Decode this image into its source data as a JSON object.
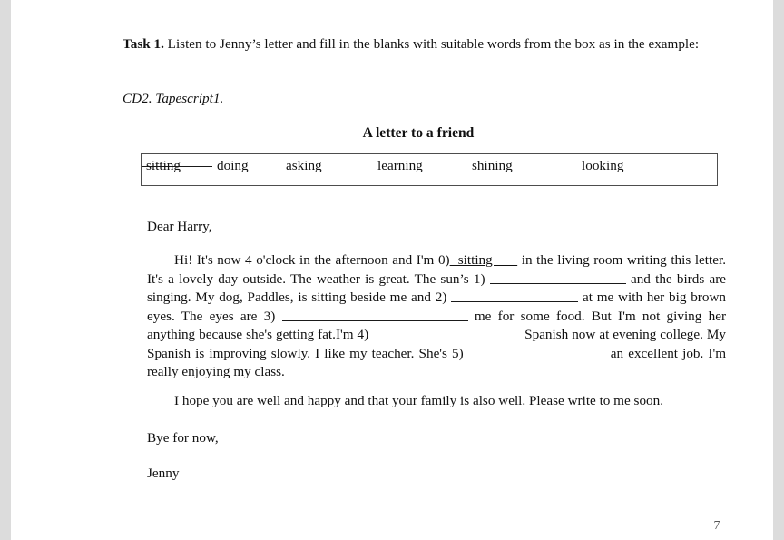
{
  "document": {
    "page_number": "7"
  },
  "task": {
    "label": "Task 1.",
    "instruction": " Listen to Jenny’s letter and fill in the blanks with suitable words from the box as in the example:",
    "tapescript": "CD2. Tapescript1."
  },
  "letter": {
    "title": "A letter to a friend",
    "salutation": "Dear Harry,",
    "signoff": "Bye for now,",
    "signature": "Jenny"
  },
  "word_bank": {
    "words": [
      {
        "text": "sitting",
        "struck": true
      },
      {
        "text": "doing",
        "struck": false
      },
      {
        "text": "asking",
        "struck": false
      },
      {
        "text": "learning",
        "struck": false
      },
      {
        "text": "shining",
        "struck": false
      },
      {
        "text": "looking",
        "struck": false
      }
    ]
  },
  "body": {
    "seg_1": "Hi! It's now 4 o'clock in the afternoon and I'm 0)",
    "example_answer": "  sitting      ",
    "seg_2": " in the living room writing this letter. It's a lovely day outside. The weather is great. The sun’s 1)",
    "seg_3": " and the birds are singing. My dog, Paddles, is sitting beside me and 2)",
    "seg_4": " at me with her big brown eyes. The eyes are 3)",
    "seg_5": " me for some food. But I'm not giving her anything because she's getting fat.I'm 4)",
    "seg_6": " Spanish now at evening college. My Spanish is improving slowly. I like my teacher. She's 5)",
    "seg_7": "an excellent job. I'm really enjoying my class.",
    "paragraph_hope": "I hope you are well and happy and that your family is also well. Please write to me soon."
  }
}
